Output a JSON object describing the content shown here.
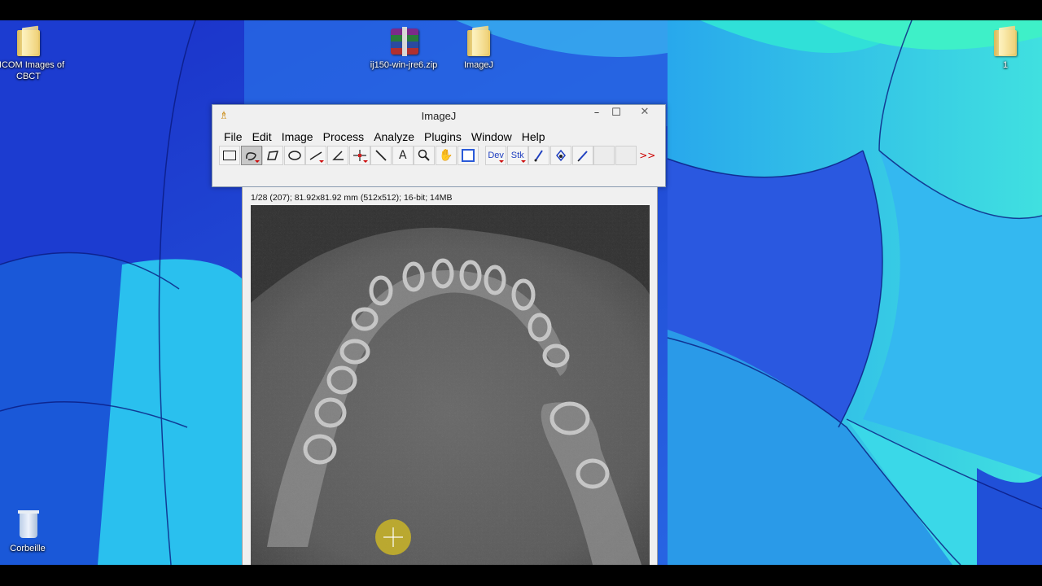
{
  "desktop": {
    "icons": [
      {
        "id": "dicom",
        "label": "DICOM Images of CBCT",
        "kind": "folder"
      },
      {
        "id": "zip",
        "label": "ij150-win-jre6.zip",
        "kind": "rar"
      },
      {
        "id": "imagej",
        "label": "ImageJ",
        "kind": "folder"
      },
      {
        "id": "one",
        "label": "1",
        "kind": "folder"
      },
      {
        "id": "bin",
        "label": "Corbeille",
        "kind": "bin"
      }
    ]
  },
  "imagej": {
    "title": "ImageJ",
    "window_buttons": {
      "minimize": "–",
      "maximize": "☐",
      "close": "✕"
    },
    "menus": [
      "File",
      "Edit",
      "Image",
      "Process",
      "Analyze",
      "Plugins",
      "Window",
      "Help"
    ],
    "toolbar": {
      "dev_label": "Dev",
      "stk_label": "Stk",
      "more_label": ">>",
      "tools": [
        "rectangle-tool",
        "freehand-tool",
        "polygon-tool",
        "oval-tool",
        "line-tool",
        "angle-tool",
        "point-tool",
        "wand-tool",
        "text-tool",
        "magnifier-tool",
        "hand-tool",
        "color-picker-tool",
        "dev-tool",
        "stk-tool",
        "brush-tool",
        "flood-fill-tool",
        "pencil-tool",
        "blank-tool-1",
        "blank-tool-2",
        "more-tools"
      ],
      "selected": "freehand-tool"
    }
  },
  "image_window": {
    "info": "1/28 (207); 81.92x81.92 mm (512x512); 16-bit; 14MB"
  },
  "colors": {
    "accent_blue": "#2a5ad8",
    "close_red": "#c75050",
    "cursor_yellow": "#d8c020"
  }
}
